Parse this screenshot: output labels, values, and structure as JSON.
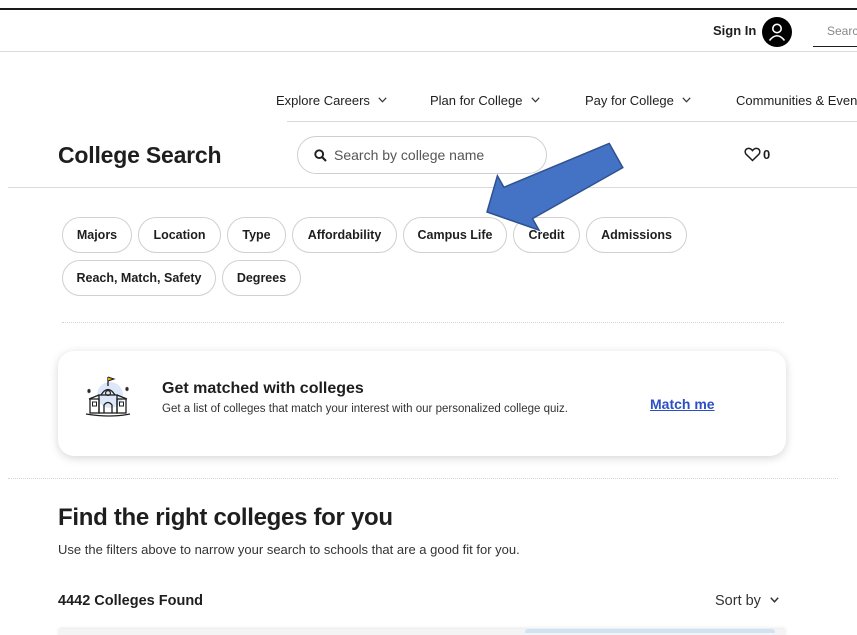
{
  "topbar": {
    "sign_in": "Sign In",
    "search_placeholder": "Search",
    "avatar_icon": "user-icon"
  },
  "nav": {
    "items": [
      {
        "label": "Explore Careers"
      },
      {
        "label": "Plan for College"
      },
      {
        "label": "Pay for College"
      },
      {
        "label": "Communities & Events"
      }
    ]
  },
  "header": {
    "title": "College Search",
    "search_placeholder": "Search by college name",
    "favorites_count": "0"
  },
  "filters": [
    {
      "label": "Majors"
    },
    {
      "label": "Location"
    },
    {
      "label": "Type"
    },
    {
      "label": "Affordability"
    },
    {
      "label": "Campus Life"
    },
    {
      "label": "Credit"
    },
    {
      "label": "Admissions"
    },
    {
      "label": "Reach, Match, Safety"
    },
    {
      "label": "Degrees"
    }
  ],
  "match_card": {
    "title": "Get matched with colleges",
    "description": "Get a list of colleges that match your interest with our personalized college quiz.",
    "link": "Match me",
    "icon": "college-building-icon"
  },
  "results": {
    "heading": "Find the right colleges for you",
    "subheading": "Use the filters above to narrow your search to schools that are a good fit for you.",
    "count": "4442 Colleges Found",
    "sort_label": "Sort by"
  },
  "annotation": {
    "arrow_color": "#4472c4",
    "arrow_outline": "#2f528f"
  },
  "colors": {
    "link": "#2c4fc4",
    "text": "#1e1e1e",
    "border": "#d0d0d0"
  }
}
